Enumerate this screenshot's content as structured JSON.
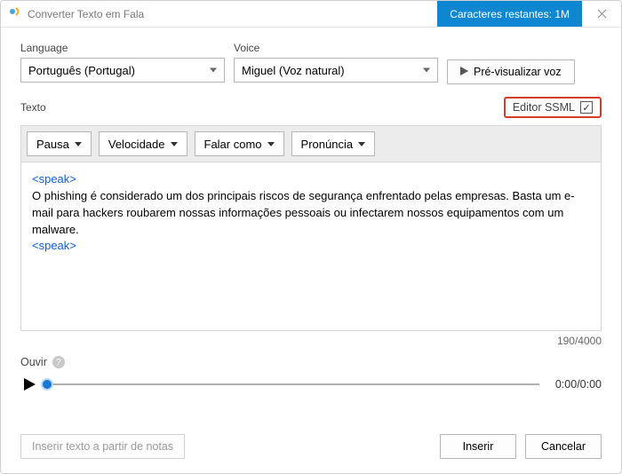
{
  "titlebar": {
    "title": "Converter Texto em Fala",
    "char_counter": "Caracteres restantes: 1M"
  },
  "fields": {
    "language_label": "Language",
    "language_value": "Português (Portugal)",
    "voice_label": "Voice",
    "voice_value": "Miguel (Voz natural)",
    "preview_btn": "Pré-visualizar voz"
  },
  "texto_block": {
    "label": "Texto",
    "editor_ssml_label": "Editor SSML",
    "toolbar": {
      "pausa": "Pausa",
      "velocidade": "Velocidade",
      "falar_como": "Falar como",
      "pronuncia": "Pronúncia"
    },
    "ssml_open": "<speak>",
    "body": "O phishing é considerado um dos principais riscos de segurança enfrentado pelas empresas. Basta um e-mail para hackers roubarem nossas informações pessoais ou infectarem nossos equipamentos com um malware.",
    "ssml_close": "<speak>",
    "counter": "190/4000"
  },
  "listen": {
    "label": "Ouvir",
    "time": "0:00/0:00"
  },
  "footer": {
    "notes_btn": "Inserir texto a partir de notas",
    "insert_btn": "Inserir",
    "cancel_btn": "Cancelar"
  }
}
